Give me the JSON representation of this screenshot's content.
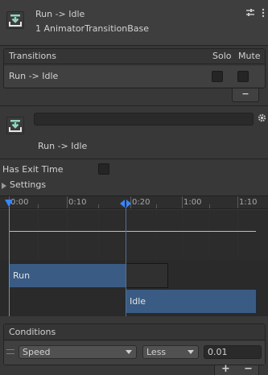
{
  "header": {
    "title": "Run -> Idle",
    "subtitle": "1 AnimatorTransitionBase"
  },
  "transitions": {
    "heading": "Transitions",
    "solo_label": "Solo",
    "mute_label": "Mute",
    "items": [
      {
        "label": "Run -> Idle",
        "solo": false,
        "mute": false
      }
    ],
    "remove_label": "−"
  },
  "transition": {
    "name_value": "",
    "label": "Run -> Idle"
  },
  "settings": {
    "has_exit_time_label": "Has Exit Time",
    "has_exit_time": false,
    "settings_label": "Settings"
  },
  "timeline": {
    "ruler_labels": [
      "0:00",
      "0:10",
      "0:20",
      "1:00",
      "1:10"
    ],
    "from_state": "Run",
    "to_state": "Idle",
    "track_color": "#3a5b83",
    "playhead_color": "#3a86ff"
  },
  "conditions": {
    "heading": "Conditions",
    "items": [
      {
        "parameter": "Speed",
        "mode": "Less",
        "threshold": "0.01"
      }
    ],
    "add_label": "+",
    "remove_label": "−"
  }
}
